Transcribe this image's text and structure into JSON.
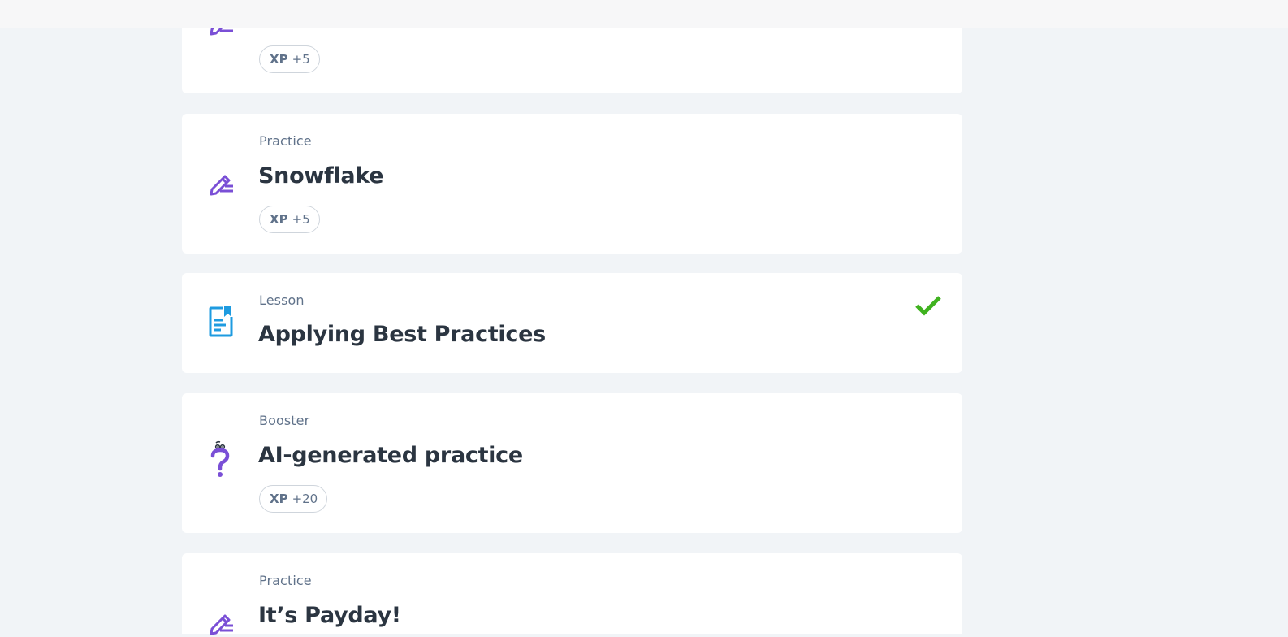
{
  "colors": {
    "page_bg": "#f1f4f7",
    "card_bg": "#ffffff",
    "practice_icon": "#7a4fd6",
    "lesson_icon": "#1e9be0",
    "booster_icon": "#7a4fd6",
    "check": "#3fb21f",
    "title_text": "#2b3541",
    "meta_text": "#60728a"
  },
  "cards": [
    {
      "type": "",
      "title": "",
      "icon": "pencil-icon",
      "xp_label": "XP",
      "xp_value": "+5",
      "completed": false
    },
    {
      "type": "Practice",
      "title": "Snowflake",
      "icon": "pencil-icon",
      "xp_label": "XP",
      "xp_value": "+5",
      "completed": false
    },
    {
      "type": "Lesson",
      "title": "Applying Best Practices",
      "icon": "lesson-document-icon",
      "completed": true
    },
    {
      "type": "Booster",
      "title": "AI-generated practice",
      "icon": "question-mark-icon",
      "xp_label": "XP",
      "xp_value": "+20",
      "completed": false
    },
    {
      "type": "Practice",
      "title": "It’s Payday!",
      "icon": "pencil-icon",
      "completed": false
    }
  ]
}
